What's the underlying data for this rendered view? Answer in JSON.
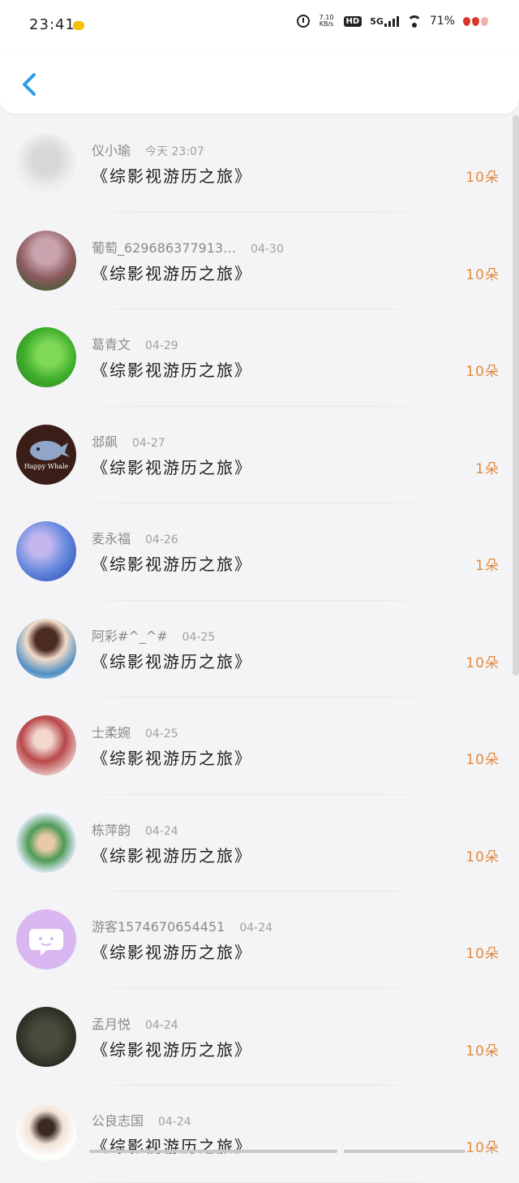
{
  "status_bar": {
    "time": "23:41",
    "net_speed": "7.10 KB/s",
    "hd": "HD",
    "network": "5G",
    "battery": "71%"
  },
  "header": {
    "back_icon": "chevron-left-icon"
  },
  "colors": {
    "accent_blue": "#2f9ae6",
    "amount_orange": "#e38a3c"
  },
  "list": [
    {
      "name": "仪小瑜",
      "date": "今天 23:07",
      "book": "《综影视游历之旅》",
      "amount": "10朵"
    },
    {
      "name": "葡萄_629686377913…",
      "date": "04-30",
      "book": "《综影视游历之旅》",
      "amount": "10朵"
    },
    {
      "name": "葛青文",
      "date": "04-29",
      "book": "《综影视游历之旅》",
      "amount": "10朵"
    },
    {
      "name": "邶飙",
      "date": "04-27",
      "book": "《综影视游历之旅》",
      "amount": "1朵",
      "avatar_text": "Happy Whale"
    },
    {
      "name": "麦永福",
      "date": "04-26",
      "book": "《综影视游历之旅》",
      "amount": "1朵"
    },
    {
      "name": "阿彩#^_^#",
      "date": "04-25",
      "book": "《综影视游历之旅》",
      "amount": "10朵"
    },
    {
      "name": "士柔婉",
      "date": "04-25",
      "book": "《综影视游历之旅》",
      "amount": "10朵"
    },
    {
      "name": "栋萍韵",
      "date": "04-24",
      "book": "《综影视游历之旅》",
      "amount": "10朵"
    },
    {
      "name": "游客1574670654451",
      "date": "04-24",
      "book": "《综影视游历之旅》",
      "amount": "10朵"
    },
    {
      "name": "孟月悦",
      "date": "04-24",
      "book": "《综影视游历之旅》",
      "amount": "10朵"
    },
    {
      "name": "公良志国",
      "date": "04-24",
      "book": "《综影视游历之旅》",
      "amount": "10朵"
    }
  ]
}
